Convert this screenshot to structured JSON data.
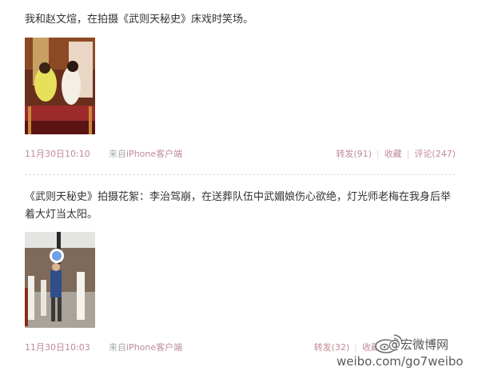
{
  "posts": [
    {
      "text": "我和赵文煊，在拍摄《武则天秘史》床戏时笑场。",
      "time": "11月30日10:10",
      "source_prefix": "来自",
      "source": "iPhone客户端",
      "repost": "转发(91)",
      "favorite": "收藏",
      "comment": "评论(247)"
    },
    {
      "text": "《武则天秘史》拍摄花絮：李治驾崩，在送葬队伍中武媚娘伤心欲绝，灯光师老梅在我身后举着大灯当太阳。",
      "time": "11月30日10:03",
      "source_prefix": "来自",
      "source": "iPhone客户端",
      "repost": "转发(32)",
      "favorite": "收藏"
    }
  ],
  "watermark": {
    "brand": "@宏微博网",
    "url": "weibo.com/go7weibo"
  },
  "colors": {
    "link": "#c08a96",
    "text": "#333333",
    "muted": "#a9a9a9"
  }
}
